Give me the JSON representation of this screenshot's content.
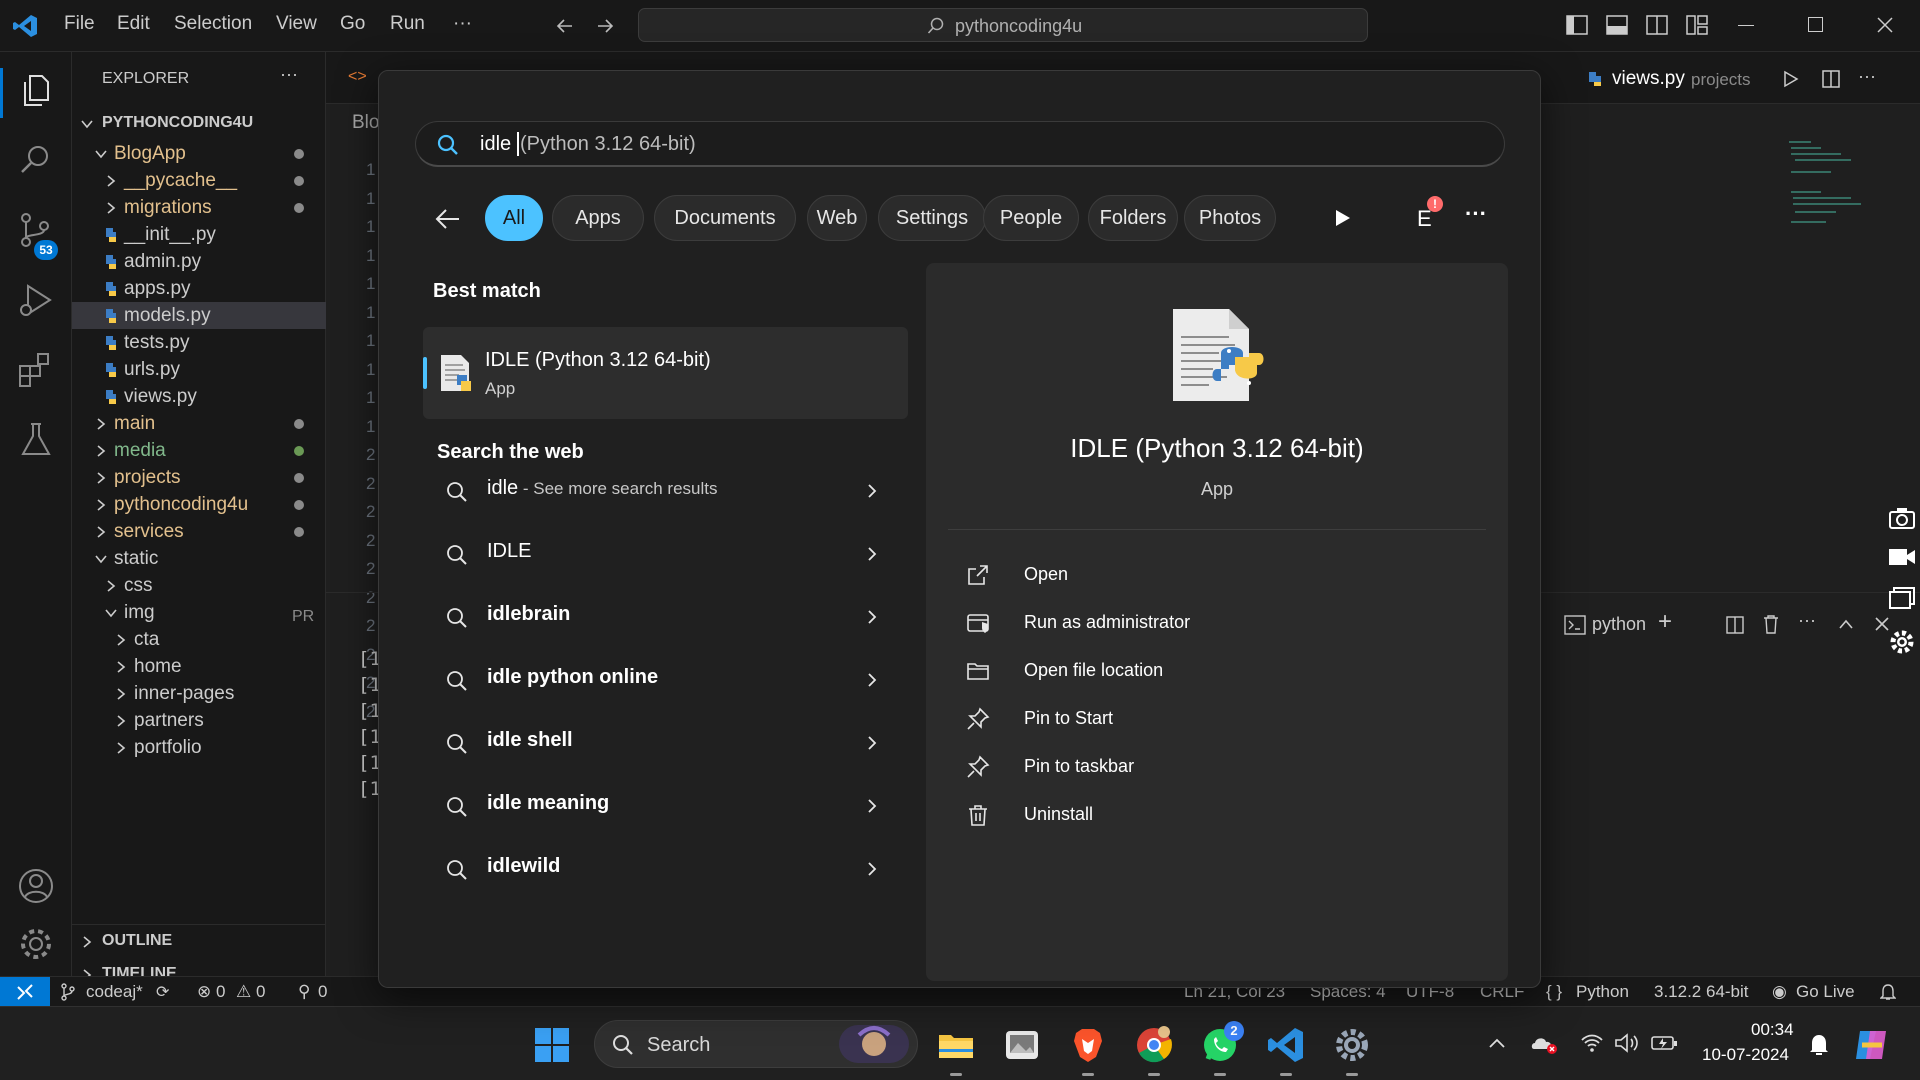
{
  "titlebar": {
    "menus": [
      "File",
      "Edit",
      "Selection",
      "View",
      "Go",
      "Run",
      "···"
    ],
    "command_center": "pythoncoding4u"
  },
  "activity": {
    "scm_badge": "53"
  },
  "explorer": {
    "title": "EXPLORER",
    "more": "···",
    "root": "PYTHONCODING4U",
    "rows": [
      {
        "label": "BlogApp"
      },
      {
        "label": "__pycache__"
      },
      {
        "label": "migrations"
      },
      {
        "label": "__init__.py"
      },
      {
        "label": "admin.py"
      },
      {
        "label": "apps.py"
      },
      {
        "label": "models.py"
      },
      {
        "label": "tests.py"
      },
      {
        "label": "urls.py"
      },
      {
        "label": "views.py"
      },
      {
        "label": "main"
      },
      {
        "label": "media"
      },
      {
        "label": "projects"
      },
      {
        "label": "pythoncoding4u"
      },
      {
        "label": "services"
      },
      {
        "label": "static"
      },
      {
        "label": "css"
      },
      {
        "label": "img"
      },
      {
        "label": "cta"
      },
      {
        "label": "home"
      },
      {
        "label": "inner-pages"
      },
      {
        "label": "partners"
      },
      {
        "label": "portfolio"
      }
    ],
    "outline": "OUTLINE",
    "timeline": "TIMELINE"
  },
  "editor": {
    "breadcrumb": "Blo",
    "right_tab_file": "views.py",
    "right_tab_folder": "projects",
    "line_numbers": [
      "1",
      "1",
      "1",
      "1",
      "1",
      "1",
      "1",
      "1",
      "1",
      "1",
      "2",
      "2",
      "2",
      "2",
      "2",
      "2",
      "2",
      "2",
      "2",
      "2"
    ],
    "panel_label": "PR",
    "terminal_lines": [
      "[1",
      "[1",
      "[1",
      "[1",
      "[1",
      "[1"
    ],
    "terminal_name": "python"
  },
  "statusbar": {
    "branch": "codeaj*",
    "errors": "0",
    "warnings": "0",
    "ports": "0",
    "position": "Ln 21, Col 23",
    "spaces": "Spaces: 4",
    "encoding": "UTF-8",
    "eol": "CRLF",
    "language": "Python",
    "interpreter": "3.12.2 64-bit",
    "golive": "Go Live"
  },
  "search_popup": {
    "typed": "idle",
    "hint": "(Python 3.12 64-bit)",
    "filters": [
      "All",
      "Apps",
      "Documents",
      "Web",
      "Settings",
      "People",
      "Folders",
      "Photos"
    ],
    "active_filter": "All",
    "account_initial": "E",
    "best_match_title": "Best match",
    "best_match": {
      "name": "IDLE (Python 3.12 64-bit)",
      "type": "App"
    },
    "web_title": "Search the web",
    "web_results": [
      {
        "query": "idle",
        "suffix": " - See more search results"
      },
      {
        "query": "IDLE",
        "suffix": ""
      },
      {
        "query": "idlebrain",
        "suffix": ""
      },
      {
        "query": "idle python online",
        "suffix": ""
      },
      {
        "query": "idle shell",
        "suffix": ""
      },
      {
        "query": "idle meaning",
        "suffix": ""
      },
      {
        "query": "idlewild",
        "suffix": ""
      }
    ],
    "detail": {
      "name": "IDLE (Python 3.12 64-bit)",
      "type": "App",
      "actions": [
        "Open",
        "Run as administrator",
        "Open file location",
        "Pin to Start",
        "Pin to taskbar",
        "Uninstall"
      ]
    }
  },
  "taskbar": {
    "search": "Search",
    "whatsapp_badge": "2",
    "time": "00:34",
    "date": "10-07-2024"
  },
  "colors": {
    "accent": "#4cc2ff",
    "vscode_blue": "#0078d4"
  }
}
